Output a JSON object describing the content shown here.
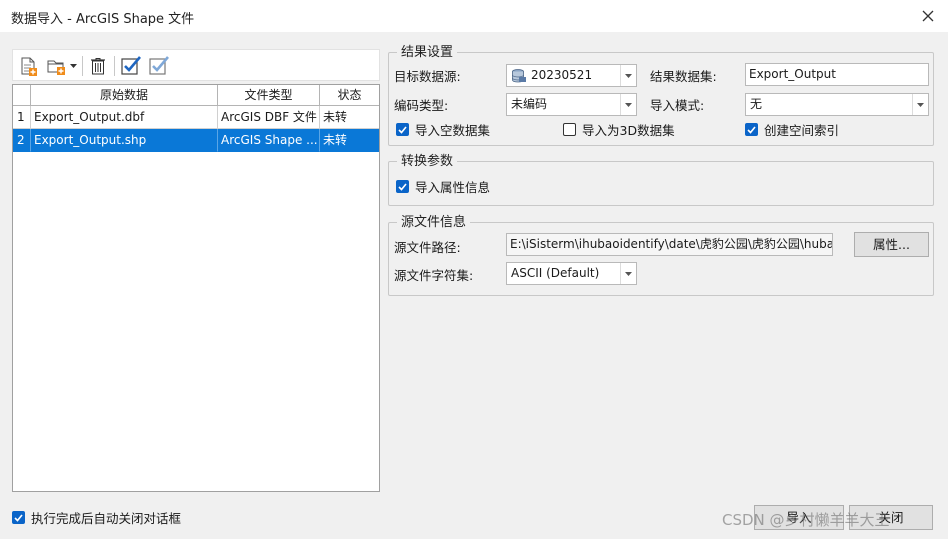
{
  "window": {
    "title": "数据导入 - ArcGIS Shape 文件",
    "close_icon": "close-icon"
  },
  "toolbar": {
    "icons": [
      "add-file-icon",
      "add-folder-icon",
      "dropdown-arrow-icon",
      "delete-icon",
      "check-all-icon",
      "check-selected-icon"
    ]
  },
  "grid": {
    "columns": [
      "原始数据",
      "文件类型",
      "状态"
    ],
    "rows": [
      {
        "num": "1",
        "name": "Export_Output.dbf",
        "type": "ArcGIS DBF 文件",
        "status": "未转"
      },
      {
        "num": "2",
        "name": "Export_Output.shp",
        "type": "ArcGIS Shape ...",
        "status": "未转"
      }
    ],
    "selected_row": 2
  },
  "result_settings": {
    "title": "结果设置",
    "target_label": "目标数据源:",
    "target_value": "20230521",
    "dataset_label": "结果数据集:",
    "dataset_value": "Export_Output",
    "encoding_label": "编码类型:",
    "encoding_value": "未编码",
    "import_mode_label": "导入模式:",
    "import_mode_value": "无",
    "import_empty_label": "导入空数据集",
    "import_empty_checked": true,
    "import_3d_label": "导入为3D数据集",
    "import_3d_checked": false,
    "spatial_index_label": "创建空间索引",
    "spatial_index_checked": true
  },
  "convert_params": {
    "title": "转换参数",
    "import_attr_label": "导入属性信息",
    "import_attr_checked": true
  },
  "source_info": {
    "title": "源文件信息",
    "path_label": "源文件路径:",
    "path_value": "E:\\iSisterm\\ihubaoidentify\\date\\虎豹公园\\虎豹公园\\hubaosh",
    "properties_button": "属性...",
    "charset_label": "源文件字符集:",
    "charset_value": "ASCII (Default)"
  },
  "footer": {
    "auto_close_label": "执行完成后自动关闭对话框",
    "auto_close_checked": true,
    "import_button": "导入",
    "close_button": "关闭"
  },
  "watermark": "CSDN @乡村懒羊羊大王",
  "colors": {
    "selection": "#0a78d7",
    "checkbox": "#0a64c8",
    "background": "#f0f0f0"
  }
}
